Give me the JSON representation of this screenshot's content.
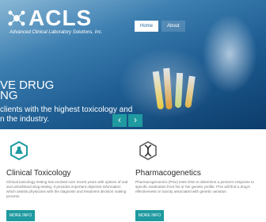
{
  "brand": {
    "name": "ACLS",
    "subtitle": "Advanced Clinical Laboratory Solutions, Inc."
  },
  "nav": {
    "items": [
      {
        "label": "Home",
        "active": true
      },
      {
        "label": "About",
        "active": false
      }
    ]
  },
  "hero": {
    "headline_line1": "VE DRUG",
    "headline_line2": "NG",
    "tagline_line1": "clients with the highest toxicology and",
    "tagline_line2": "n the industry.",
    "prev_label": "‹",
    "next_label": "›"
  },
  "cards": [
    {
      "icon": "hexagon-flask-icon",
      "title": "Clinical Toxicology",
      "body": "Clinical toxicology testing has evolved over recent years with options of oral and urine/blood drug testing. It provides important objective information which assists physicians with the diagnosis and treatment decision making process.",
      "button_label": "MORE INFO"
    },
    {
      "icon": "dna-icon",
      "title": "Pharmacogenetics",
      "body": "Pharmacogenomics (PGx) tests DNA to determine a person's response to specific medication from his or her genetic profile. PGx will find a drug's effectiveness or toxicity associated with genetic variation.",
      "button_label": "MORE INFO"
    }
  ],
  "colors": {
    "accent": "#1e9aa0",
    "hero_dark": "#0c3c6b",
    "hero_light": "#8ab8d6"
  }
}
